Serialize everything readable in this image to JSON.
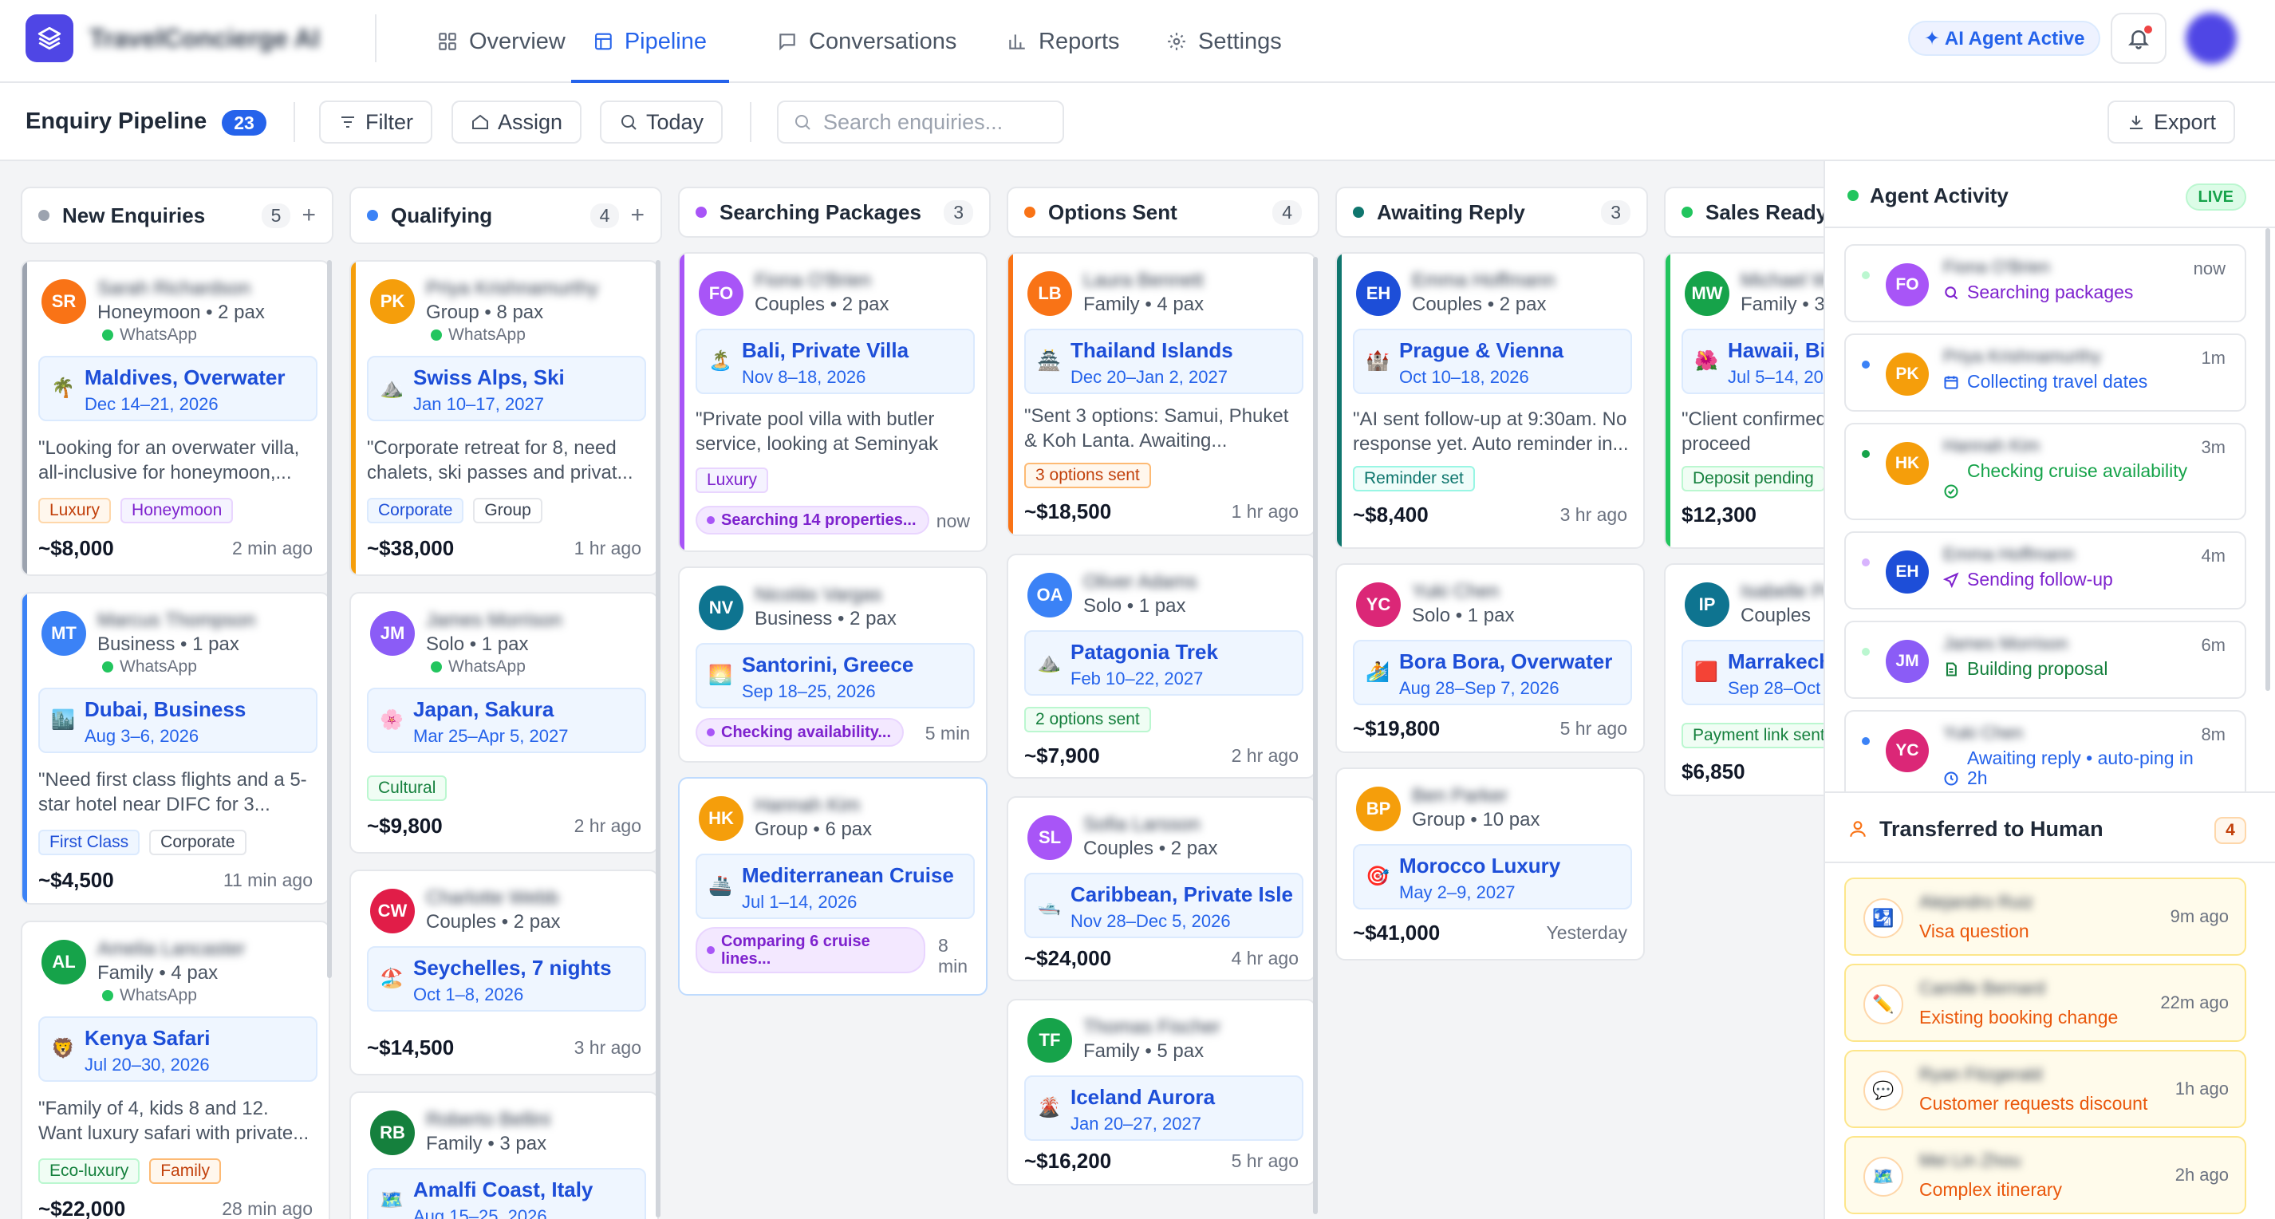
{
  "app": {
    "brand": "TravelConcierge AI"
  },
  "nav": {
    "tabs": [
      {
        "label": "Overview"
      },
      {
        "label": "Pipeline"
      },
      {
        "label": "Conversations"
      },
      {
        "label": "Reports"
      },
      {
        "label": "Settings"
      }
    ],
    "agent_status": "✦ AI Agent Active"
  },
  "toolbar": {
    "title": "Enquiry Pipeline",
    "count": "23",
    "filter": "Filter",
    "assign": "Assign",
    "today": "Today",
    "search_placeholder": "Search enquiries...",
    "export": "Export"
  },
  "columns": [
    {
      "title": "New Enquiries",
      "count": "5",
      "color": "#9ca3af",
      "cards": [
        {
          "initials": "SR",
          "name": "Sarah Richardson",
          "meta": "Honeymoon • 2 pax",
          "channel": "WhatsApp",
          "dest": "Maldives, Overwater",
          "dates": "Dec 14–21, 2026",
          "icon": "🌴",
          "quote": "\"Looking for an overwater villa, all-inclusive for honeymoon,...",
          "tags": [
            "Luxury",
            "Honeymoon"
          ],
          "price": "~$8,000",
          "time": "2 min ago"
        },
        {
          "initials": "MT",
          "name": "Marcus Thompson",
          "meta": "Business • 1 pax",
          "channel": "WhatsApp",
          "dest": "Dubai, Business",
          "dates": "Aug 3–6, 2026",
          "icon": "🏙️",
          "quote": "\"Need first class flights and a 5-star hotel near DIFC for 3...",
          "tags": [
            "First Class",
            "Corporate"
          ],
          "price": "~$4,500",
          "time": "11 min ago"
        },
        {
          "initials": "AL",
          "name": "Amelia Lancaster",
          "meta": "Family • 4 pax",
          "channel": "WhatsApp",
          "dest": "Kenya Safari",
          "dates": "Jul 20–30, 2026",
          "icon": "🦁",
          "quote": "\"Family of 4, kids 8 and 12. Want luxury safari with private...",
          "tags": [
            "Eco-luxury",
            "Family"
          ],
          "price": "~$22,000",
          "time": "28 min ago"
        }
      ]
    },
    {
      "title": "Qualifying",
      "count": "4",
      "color": "#3b82f6",
      "cards": [
        {
          "initials": "PK",
          "name": "Priya Krishnamurthy",
          "meta": "Group • 8 pax",
          "channel": "WhatsApp",
          "dest": "Swiss Alps, Ski",
          "dates": "Jan 10–17, 2027",
          "icon": "⛰️",
          "quote": "\"Corporate retreat for 8, need chalets, ski passes and privat...",
          "tags": [
            "Corporate",
            "Group"
          ],
          "price": "~$38,000",
          "time": "1 hr ago"
        },
        {
          "initials": "JM",
          "name": "James Morrison",
          "meta": "Solo • 1 pax",
          "channel": "WhatsApp",
          "dest": "Japan, Sakura",
          "dates": "Mar 25–Apr 5, 2027",
          "icon": "🌸",
          "tags": [
            "Cultural"
          ],
          "price": "~$9,800",
          "time": "2 hr ago"
        },
        {
          "initials": "CW",
          "name": "Charlotte Webb",
          "meta": "Couples • 2 pax",
          "dest": "Seychelles, 7 nights",
          "dates": "Oct 1–8, 2026",
          "icon": "🏖️",
          "price": "~$14,500",
          "time": "3 hr ago"
        },
        {
          "initials": "RB",
          "name": "Roberto Bellini",
          "meta": "Family • 3 pax",
          "dest": "Amalfi Coast, Italy",
          "dates": "Aug 15–25, 2026",
          "icon": "🗺️"
        }
      ]
    },
    {
      "title": "Searching Packages",
      "count": "3",
      "color": "#a855f7",
      "cards": [
        {
          "initials": "FO",
          "name": "Fiona O'Brien",
          "meta": "Couples • 2 pax",
          "dest": "Bali, Private Villa",
          "dates": "Nov 8–18, 2026",
          "icon": "🏝️",
          "quote": "\"Private pool villa with butler service, looking at Seminyak or...",
          "tags": [
            "Luxury"
          ],
          "status": "Searching 14 properties...",
          "time": "now"
        },
        {
          "initials": "NV",
          "name": "Nicolás Vargas",
          "meta": "Business • 2 pax",
          "dest": "Santorini, Greece",
          "dates": "Sep 18–25, 2026",
          "icon": "🌅",
          "status": "Checking availability...",
          "time": "5 min"
        },
        {
          "initials": "HK",
          "name": "Hannah Kim",
          "meta": "Group • 6 pax",
          "dest": "Mediterranean Cruise",
          "dates": "Jul 1–14, 2026",
          "icon": "🚢",
          "status": "Comparing 6 cruise lines...",
          "time": "8 min"
        }
      ]
    },
    {
      "title": "Options Sent",
      "count": "4",
      "color": "#f97316",
      "cards": [
        {
          "initials": "LB",
          "name": "Laura Bennett",
          "meta": "Family • 4 pax",
          "dest": "Thailand Islands",
          "dates": "Dec 20–Jan 2, 2027",
          "icon": "🏯",
          "quote": "\"Sent 3 options: Samui, Phuket & Koh Lanta. Awaiting...",
          "tags": [
            "3 options sent"
          ],
          "price": "~$18,500",
          "time": "1 hr ago"
        },
        {
          "initials": "OA",
          "name": "Oliver Adams",
          "meta": "Solo • 1 pax",
          "dest": "Patagonia Trek",
          "dates": "Feb 10–22, 2027",
          "icon": "⛰️",
          "tags": [
            "2 options sent"
          ],
          "price": "~$7,900",
          "time": "2 hr ago"
        },
        {
          "initials": "SL",
          "name": "Sofia Larsson",
          "meta": "Couples • 2 pax",
          "dest": "Caribbean, Private Isle",
          "dates": "Nov 28–Dec 5, 2026",
          "icon": "🛥️",
          "price": "~$24,000",
          "time": "4 hr ago"
        },
        {
          "initials": "TF",
          "name": "Thomas Fischer",
          "meta": "Family • 5 pax",
          "dest": "Iceland Aurora",
          "dates": "Jan 20–27, 2027",
          "icon": "🌋",
          "price": "~$16,200",
          "time": "5 hr ago"
        }
      ]
    },
    {
      "title": "Awaiting Reply",
      "count": "3",
      "color": "#0f766e",
      "cards": [
        {
          "initials": "EH",
          "name": "Emma Hoffmann",
          "meta": "Couples • 2 pax",
          "dest": "Prague & Vienna",
          "dates": "Oct 10–18, 2026",
          "icon": "🏰",
          "quote": "\"AI sent follow-up at 9:30am. No response yet. Auto reminder in...",
          "tags": [
            "Reminder set"
          ],
          "price": "~$8,400",
          "time": "3 hr ago"
        },
        {
          "initials": "YC",
          "name": "Yuki Chen",
          "meta": "Solo • 1 pax",
          "dest": "Bora Bora, Overwater",
          "dates": "Aug 28–Sep 7, 2026",
          "icon": "🏄",
          "price": "~$19,800",
          "time": "5 hr ago"
        },
        {
          "initials": "BP",
          "name": "Ben Parker",
          "meta": "Group • 10 pax",
          "dest": "Morocco Luxury",
          "dates": "May 2–9, 2027",
          "icon": "🎯",
          "price": "~$41,000",
          "time": "Yesterday"
        }
      ]
    },
    {
      "title": "Sales Ready",
      "count": "",
      "color": "#22c55e",
      "cards": [
        {
          "initials": "MW",
          "name": "Michael Wright",
          "meta": "Family • 3",
          "dest": "Hawaii, Big",
          "dates": "Jul 5–14, 20",
          "icon": "🌺",
          "quote": "\"Client confirmed. Ready to proceed",
          "tags": [
            "Deposit pending"
          ],
          "price": "$12,300"
        },
        {
          "initials": "IP",
          "name": "Isabelle Petit",
          "meta": "Couples",
          "dest": "Marrakech",
          "dates": "Sep 28–Oct",
          "icon": "🟥",
          "tags": [
            "Payment link sent"
          ],
          "price": "$6,850"
        }
      ]
    }
  ],
  "activity": {
    "title": "Agent Activity",
    "live": "LIVE",
    "items": [
      {
        "initials": "FO",
        "name": "Fiona O'Brien",
        "text": "Searching packages",
        "time": "now",
        "color": "#7e22ce",
        "icon": "search-icon"
      },
      {
        "initials": "PK",
        "name": "Priya Krishnamurthy",
        "text": "Collecting travel dates",
        "time": "1m",
        "color": "#2563eb",
        "icon": "calendar-icon"
      },
      {
        "initials": "HK",
        "name": "Hannah Kim",
        "text": "Checking cruise availability",
        "time": "3m",
        "color": "#16a34a",
        "icon": "check-circle-icon"
      },
      {
        "initials": "EH",
        "name": "Emma Hoffmann",
        "text": "Sending follow-up",
        "time": "4m",
        "color": "#7e22ce",
        "icon": "send-icon"
      },
      {
        "initials": "JM",
        "name": "James Morrison",
        "text": "Building proposal",
        "time": "6m",
        "color": "#15803d",
        "icon": "document-icon"
      },
      {
        "initials": "YC",
        "name": "Yuki Chen",
        "text": "Awaiting reply • auto-ping in 2h",
        "time": "8m",
        "color": "#2563eb",
        "icon": "clock-icon"
      }
    ]
  },
  "transferred": {
    "title": "Transferred to Human",
    "count": "4",
    "items": [
      {
        "name": "Alejandro Ruiz",
        "reason": "Visa question",
        "time": "9m ago",
        "icon": "🛂"
      },
      {
        "name": "Camille Bernard",
        "reason": "Existing booking change",
        "time": "22m ago",
        "icon": "✏️"
      },
      {
        "name": "Ryan Fitzgerald",
        "reason": "Customer requests discount",
        "time": "1h ago",
        "icon": "💬"
      },
      {
        "name": "Mei Lin Zhou",
        "reason": "Complex itinerary",
        "time": "2h ago",
        "icon": "🗺️"
      }
    ]
  }
}
